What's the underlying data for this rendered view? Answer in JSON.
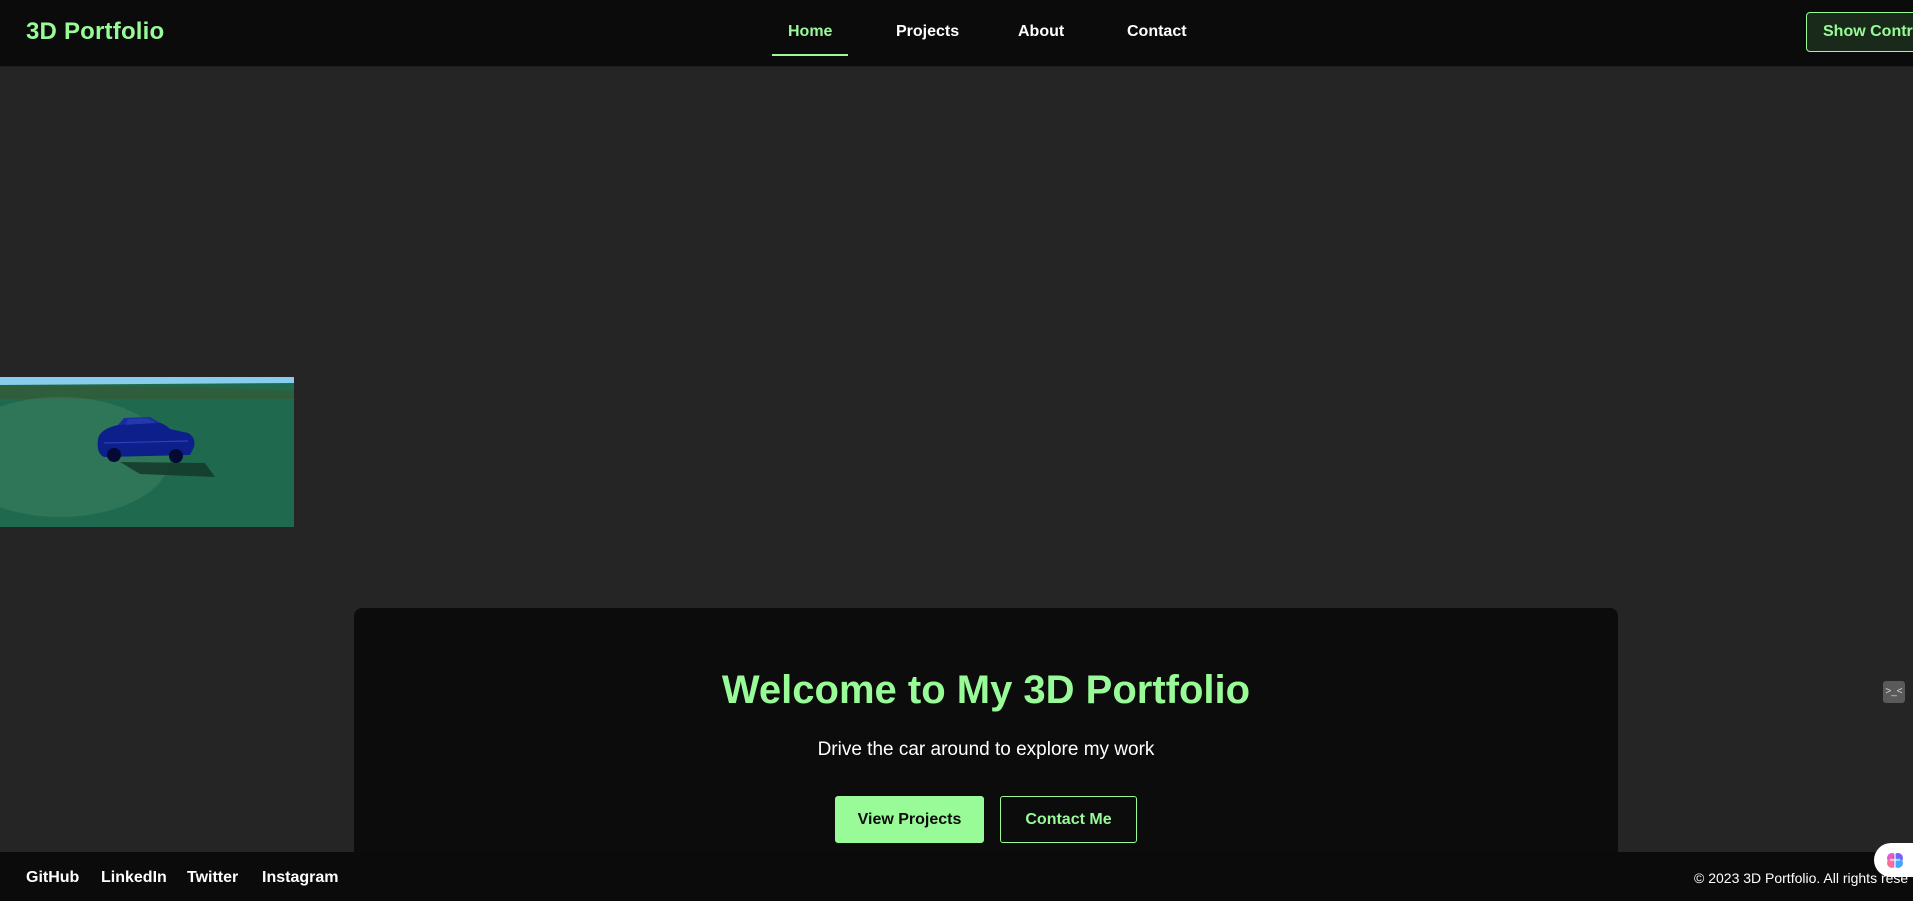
{
  "header": {
    "brand": "3D Portfolio",
    "nav": [
      {
        "label": "Home",
        "active": true
      },
      {
        "label": "Projects",
        "active": false
      },
      {
        "label": "About",
        "active": false
      },
      {
        "label": "Contact",
        "active": false
      }
    ],
    "show_controls_label": "Show Contro"
  },
  "viewport": {
    "scene": "blue car on green ground under sky",
    "icon": "car-icon"
  },
  "hero": {
    "title": "Welcome to My 3D Portfolio",
    "subtitle": "Drive the car around to explore my work",
    "primary_button": "View Projects",
    "secondary_button": "Contact Me"
  },
  "footer": {
    "links": [
      "GitHub",
      "LinkedIn",
      "Twitter",
      "Instagram"
    ],
    "copyright": "© 2023 3D Portfolio. All rights rese"
  },
  "widgets": {
    "side_widget_icon": "code-icon",
    "assistant_icon": "brain-icon"
  },
  "colors": {
    "accent": "#98fb98",
    "background": "#252525",
    "bar": "#0b0b0b",
    "card": "#0c0c0c"
  }
}
